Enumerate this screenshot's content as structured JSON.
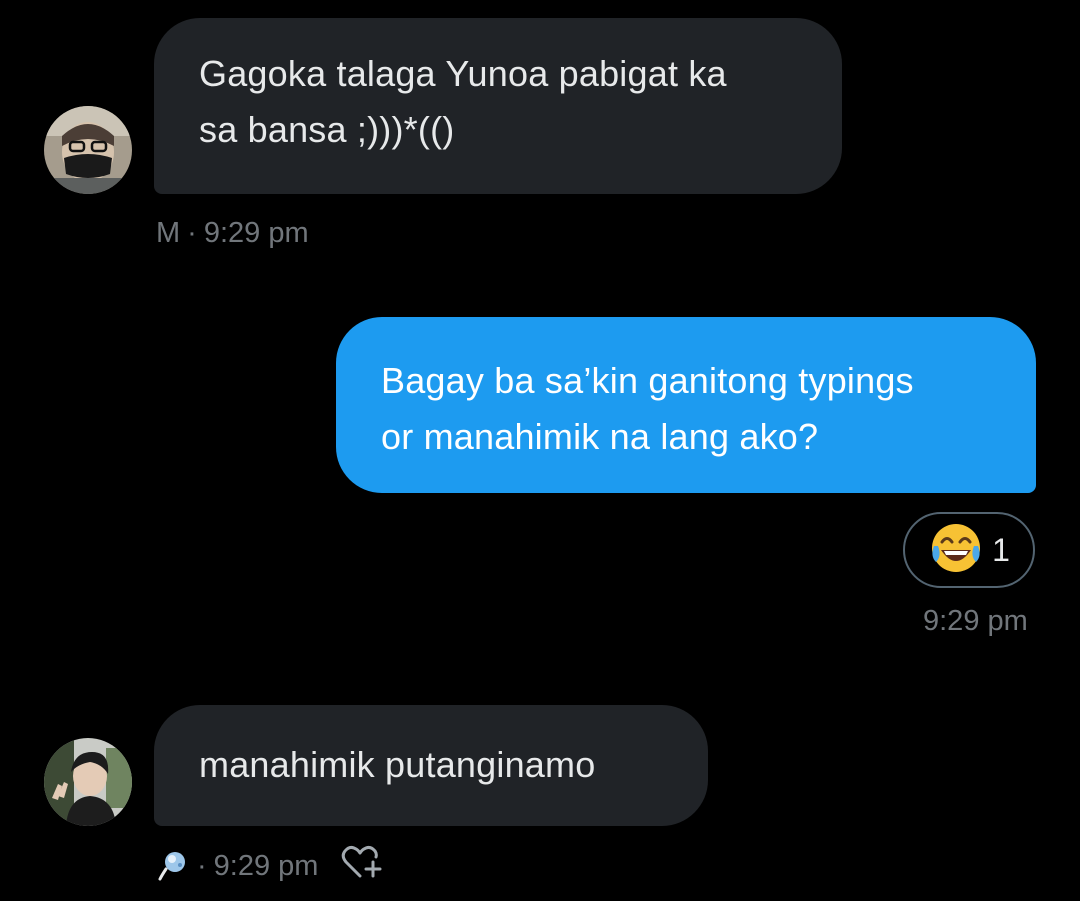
{
  "messages": [
    {
      "direction": "incoming",
      "sender_initial": "M",
      "lines": [
        "Gagoka talaga Yunoa pabigat ka",
        "sa bansa ;)))*(()"
      ],
      "time": "9:29 pm",
      "separator": "·"
    },
    {
      "direction": "outgoing",
      "lines": [
        "Bagay ba sa’kin ganitong typings",
        "or manahimik na lang ako?"
      ],
      "reaction": {
        "emoji": "face-with-tears-of-joy",
        "count": "1"
      },
      "time": "9:29 pm"
    },
    {
      "direction": "incoming",
      "lines": [
        "manahimik putanginamo"
      ],
      "time": "9:29 pm",
      "separator": "·"
    }
  ],
  "colors": {
    "background": "#000000",
    "incoming_bubble": "#202327",
    "outgoing_bubble": "#1d9bf0",
    "text": "#e7e9ea",
    "meta_text": "#71767b"
  }
}
